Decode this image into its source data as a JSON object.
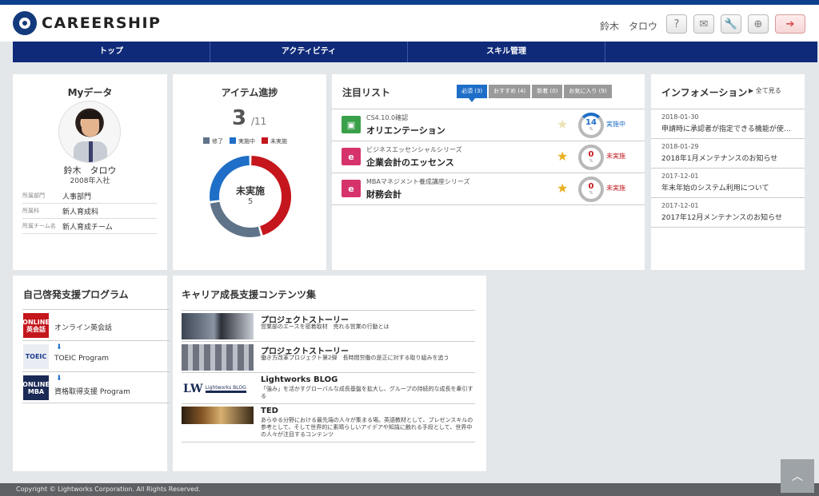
{
  "header": {
    "logo_text": "CAREERSHIP",
    "user_name": "鈴木　タロウ",
    "buttons": [
      "?",
      "✉",
      "🔧",
      "⊕",
      "➔"
    ]
  },
  "nav": [
    {
      "label": "トップ"
    },
    {
      "label": "アクティビティ"
    },
    {
      "label": "スキル管理"
    },
    {
      "label": ""
    }
  ],
  "mydata": {
    "title": "Myデータ",
    "name": "鈴木　タロウ",
    "year": "2008年入社",
    "rows": [
      {
        "key": "所属部門",
        "value": "人事部門"
      },
      {
        "key": "所属科",
        "value": "新人育成科"
      },
      {
        "key": "所属チーム名",
        "value": "新人育成チーム"
      }
    ]
  },
  "progress": {
    "title": "アイテム進捗",
    "done": "3",
    "total": "/11",
    "legend": [
      {
        "label": "修了",
        "color": "#5f7389"
      },
      {
        "label": "実施中",
        "color": "#1f6ec7"
      },
      {
        "label": "未実施",
        "color": "#c4161c"
      }
    ],
    "center_label": "未実施",
    "center_value": "5",
    "segments": {
      "not_started": 5,
      "in_progress": 3,
      "completed": 3
    }
  },
  "attention": {
    "title": "注目リスト",
    "tabs": [
      "必須 (3)",
      "おすすめ (4)",
      "新着 (0)",
      "お気に入り (9)"
    ],
    "items": [
      {
        "sub": "CS4.10.0確認",
        "title": "オリエンテーション",
        "progress": "14",
        "status": "実施中",
        "status_color": "#1f6ec7",
        "star_color": "#ece1b4",
        "icon_color": "#3aa04a"
      },
      {
        "sub": "ビジネスエッセンシャルシリーズ",
        "title": "企業会計のエッセンス",
        "progress": "0",
        "status": "未実施",
        "status_color": "#c4161c",
        "star_color": "#e6b01e",
        "icon_color": "#d6336c"
      },
      {
        "sub": "MBAマネジメント養成講座シリーズ",
        "title": "財務会計",
        "progress": "0",
        "status": "未実施",
        "status_color": "#c4161c",
        "star_color": "#e6b01e",
        "icon_color": "#d6336c"
      }
    ],
    "percent_symbol": "%"
  },
  "info": {
    "title": "インフォメーション",
    "see_all": "▶ 全て見る",
    "items": [
      {
        "date": "2018-01-30",
        "text": "申請時に承認者が指定できる機能が使…"
      },
      {
        "date": "2018-01-29",
        "text": "2018年1月メンテナンスのお知らせ"
      },
      {
        "date": "2017-12-01",
        "text": "年末年始のシステム利用について"
      },
      {
        "date": "2017-12-01",
        "text": "2017年12月メンテナンスのお知らせ"
      }
    ]
  },
  "selfdev": {
    "title": "自己啓発支援プログラム",
    "items": [
      {
        "logo": "ONLINE\n英会話",
        "logo_color": "#c4161c",
        "label": "オンライン英会話",
        "download": false
      },
      {
        "logo": "TOEIC",
        "logo_color": "#e9edf3",
        "label": "TOEIC Program",
        "download": true
      },
      {
        "logo": "ONLINE\nMBA",
        "logo_color": "#1a2a55",
        "label": "資格取得支援 Program",
        "download": true
      }
    ]
  },
  "career": {
    "title": "キャリア成長支援コンテンツ集",
    "items": [
      {
        "title": "プロジェクトストーリー",
        "desc": "営業部のエースを密着取材　売れる営業の行動とは"
      },
      {
        "title": "プロジェクトストーリー",
        "desc": "働き方改革プロジェクト第2弾　長時間労働の是正に対する取り組みを追う"
      },
      {
        "title": "Lightworks BLOG",
        "desc": "「強み」を活かすグローバルな成長基盤を拡大し、グループの持続的な成長を牽引する"
      },
      {
        "title": "TED",
        "desc": "あらゆる分野における最先端の人々が集まる場。英語教材として、プレゼンスキルの参考として、そして世界的に素晴らしいアイデアや知識に触れる手段として、世界中の人々が注目するコンテンツ"
      }
    ]
  },
  "footer": {
    "text": "Copyright © Lightworks Corporation. All Rights Reserved."
  },
  "colors": {
    "brand": "#0f2a78",
    "accent": "#1f6ec7",
    "alert": "#c4161c"
  }
}
